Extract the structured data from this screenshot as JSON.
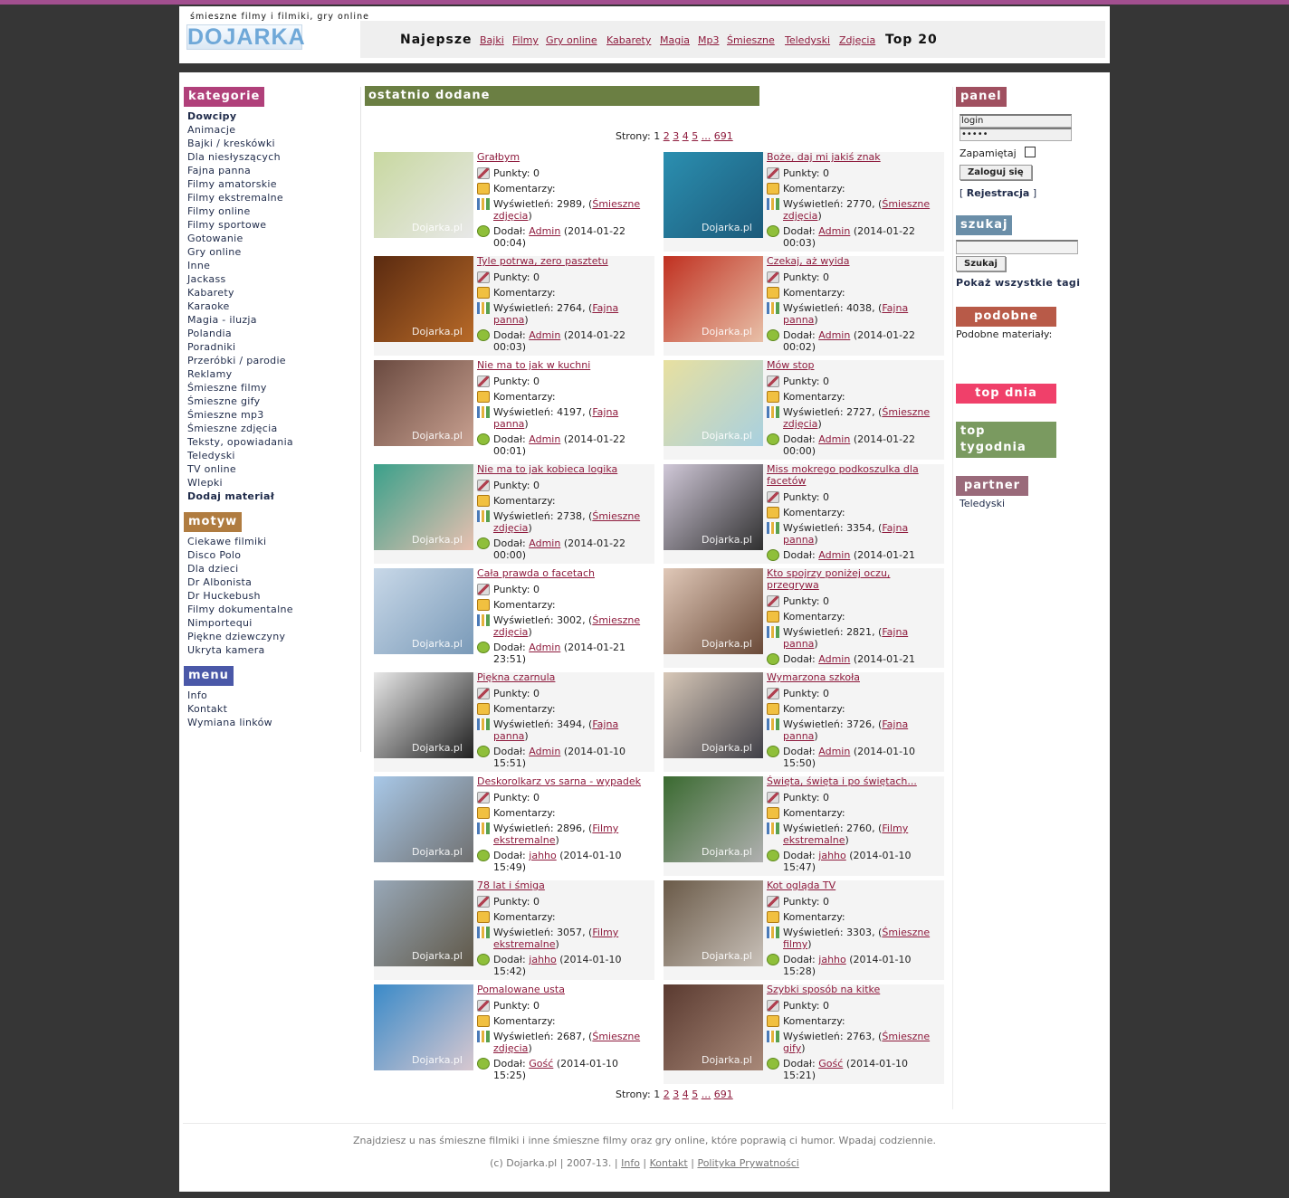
{
  "header": {
    "tagline": "śmieszne filmy i filmiki, gry online",
    "logo": "DOJARKA",
    "best": "Najepsze",
    "top20": "Top 20",
    "nav": [
      "Bajki",
      "Filmy",
      "Gry online",
      "Kabarety",
      "Magia",
      "Mp3",
      "Śmieszne",
      "Teledyski",
      "Zdjęcia"
    ]
  },
  "left": {
    "kategorie_title": "kategorie",
    "kategorie": [
      "Dowcipy",
      "Animacje",
      "Bajki / kreskówki",
      "Dla niesłyszących",
      "Fajna panna",
      "Filmy amatorskie",
      "Filmy ekstremalne",
      "Filmy online",
      "Filmy sportowe",
      "Gotowanie",
      "Gry online",
      "Inne",
      "Jackass",
      "Kabarety",
      "Karaoke",
      "Magia - iluzja",
      "Polandia",
      "Poradniki",
      "Przeróbki / parodie",
      "Reklamy",
      "Śmieszne filmy",
      "Śmieszne gify",
      "Śmieszne mp3",
      "Śmieszne zdjęcia",
      "Teksty, opowiadania",
      "Teledyski",
      "TV online",
      "Wlepki",
      "Dodaj materiał"
    ],
    "motyw_title": "motyw",
    "motyw": [
      "Ciekawe filmiki",
      "Disco Polo",
      "Dla dzieci",
      "Dr Albonista",
      "Dr Huckebush",
      "Filmy dokumentalne",
      "Nimportequi",
      "Piękne dziewczyny",
      "Ukryta kamera"
    ],
    "menu_title": "menu",
    "menu": [
      "Info",
      "Kontakt",
      "Wymiana linków"
    ]
  },
  "center": {
    "section_title": "ostatnio dodane",
    "pager_label": "Strony:",
    "pages": [
      "1",
      "2",
      "3",
      "4",
      "5",
      "...",
      "691"
    ],
    "labels": {
      "points": "Punkty:",
      "comments": "Komentarzy:",
      "views": "Wyświetleń:",
      "added": "Dodał:"
    },
    "watermark": "Dojarka.pl",
    "items": [
      {
        "title": "Grałbym",
        "points": "0",
        "views": "2989",
        "category": "Śmieszne zdjęcia",
        "user": "Admin",
        "date": "(2014-01-22 00:04)",
        "colors": [
          "#c8d8a0",
          "#e8e8e8"
        ]
      },
      {
        "title": "Boże, daj mi jakiś znak",
        "points": "0",
        "views": "2770",
        "category": "Śmieszne zdjęcia",
        "user": "Admin",
        "date": "(2014-01-22 00:03)",
        "colors": [
          "#2b8fb0",
          "#1c5a7a"
        ]
      },
      {
        "title": "Tyle potrwa, zero pasztetu",
        "points": "0",
        "views": "2764",
        "category": "Fajna panna",
        "user": "Admin",
        "date": "(2014-01-22 00:03)",
        "colors": [
          "#5a2a10",
          "#b86a28"
        ]
      },
      {
        "title": "Czekaj, aż wyida",
        "points": "0",
        "views": "4038",
        "category": "Fajna panna",
        "user": "Admin",
        "date": "(2014-01-22 00:02)",
        "colors": [
          "#c03020",
          "#e8c0a8"
        ]
      },
      {
        "title": "Nie ma to jak w kuchni",
        "points": "0",
        "views": "4197",
        "category": "Fajna panna",
        "user": "Admin",
        "date": "(2014-01-22 00:01)",
        "colors": [
          "#6a4a40",
          "#c8a090"
        ]
      },
      {
        "title": "Mów stop",
        "points": "0",
        "views": "2727",
        "category": "Śmieszne zdjęcia",
        "user": "Admin",
        "date": "(2014-01-22 00:00)",
        "colors": [
          "#e8e0a0",
          "#a8d0e0"
        ]
      },
      {
        "title": "Nie ma to jak kobieca logika",
        "points": "0",
        "views": "2738",
        "category": "Śmieszne zdjęcia",
        "user": "Admin",
        "date": "(2014-01-22 00:00)",
        "colors": [
          "#3aa08a",
          "#e8c0b0"
        ]
      },
      {
        "title": "Miss mokrego podkoszulka dla facetów",
        "points": "0",
        "views": "3354",
        "category": "Fajna panna",
        "user": "Admin",
        "date": "(2014-01-21",
        "colors": [
          "#d0c8d8",
          "#303030"
        ]
      },
      {
        "title": "Cała prawda o facetach",
        "points": "0",
        "views": "3002",
        "category": "Śmieszne zdjęcia",
        "user": "Admin",
        "date": "(2014-01-21 23:51)",
        "colors": [
          "#c8d8e8",
          "#7a9ab8"
        ]
      },
      {
        "title": "Kto spojrzy poniżej oczu, przegrywa",
        "points": "0",
        "views": "2821",
        "category": "Fajna panna",
        "user": "Admin",
        "date": "(2014-01-21",
        "colors": [
          "#e0c8b8",
          "#6a4a38"
        ]
      },
      {
        "title": "Piękna czarnula",
        "points": "0",
        "views": "3494",
        "category": "Fajna panna",
        "user": "Admin",
        "date": "(2014-01-10 15:51)",
        "colors": [
          "#e8e8e8",
          "#202020"
        ]
      },
      {
        "title": "Wymarzona szkoła",
        "points": "0",
        "views": "3726",
        "category": "Fajna panna",
        "user": "Admin",
        "date": "(2014-01-10 15:50)",
        "colors": [
          "#d8c8b8",
          "#404048"
        ]
      },
      {
        "title": "Deskorolkarz vs sarna - wypadek",
        "points": "0",
        "views": "2896",
        "category": "Filmy ekstremalne",
        "user": "jahho",
        "date": "(2014-01-10 15:49)",
        "colors": [
          "#a8c8e8",
          "#707070"
        ]
      },
      {
        "title": "Święta, święta i po świętach...",
        "points": "0",
        "views": "2760",
        "category": "Filmy ekstremalne",
        "user": "jahho",
        "date": "(2014-01-10 15:47)",
        "colors": [
          "#3a6a30",
          "#b0b0b0"
        ]
      },
      {
        "title": "78 lat i śmiga",
        "points": "0",
        "views": "3057",
        "category": "Filmy ekstremalne",
        "user": "jahho",
        "date": "(2014-01-10 15:42)",
        "colors": [
          "#98a8b8",
          "#605848"
        ]
      },
      {
        "title": "Kot ogląda TV",
        "points": "0",
        "views": "3303",
        "category": "Śmieszne filmy",
        "user": "jahho",
        "date": "(2014-01-10 15:28)",
        "colors": [
          "#6a5a48",
          "#c8c0b8"
        ]
      },
      {
        "title": "Pomalowane usta",
        "points": "0",
        "views": "2687",
        "category": "Śmieszne zdjęcia",
        "user": "Gość",
        "date": "(2014-01-10 15:25)",
        "colors": [
          "#3a8ac8",
          "#d8c8d0"
        ]
      },
      {
        "title": "Szybki sposób na kitke",
        "points": "0",
        "views": "2763",
        "category": "Śmieszne gify",
        "user": "Gość",
        "date": "(2014-01-10 15:21)",
        "colors": [
          "#5a3a30",
          "#a88878"
        ]
      }
    ]
  },
  "right": {
    "panel_title": "panel",
    "login_value": "login",
    "password_value": "•••••",
    "remember": "Zapamiętaj",
    "login_btn": "Zaloguj się",
    "register_prefix": "[ ",
    "register": "Rejestracja",
    "register_suffix": " ]",
    "szukaj_title": "szukaj",
    "search_btn": "Szukaj",
    "all_tags": "Pokaż wszystkie tagi",
    "podobne_title": "podobne",
    "podobne_text": "Podobne materiały:",
    "topdnia_title": "top dnia",
    "toptyg_title": "top tygodnia",
    "partner_title": "partner",
    "partner_link": "Teledyski"
  },
  "footer": {
    "line1": "Znajdziesz u nas śmieszne filmiki i inne śmieszne filmy oraz gry online, które poprawią ci humor. Wpadaj codziennie.",
    "copyright": "(c) Dojarka.pl | 2007-13. |",
    "links": [
      "Info",
      "Kontakt",
      "Polityka Prywatności"
    ]
  },
  "colors": {
    "kategorie": "#b0407a",
    "motyw": "#b07c40",
    "menu": "#4a58a8",
    "panel": "#a05060",
    "szukaj": "#6a8ea8",
    "podobne": "#b85a48",
    "topdnia": "#f0406a",
    "toptyg": "#7a9a60",
    "partner": "#9a6a7a",
    "section": "#6b7f43"
  }
}
